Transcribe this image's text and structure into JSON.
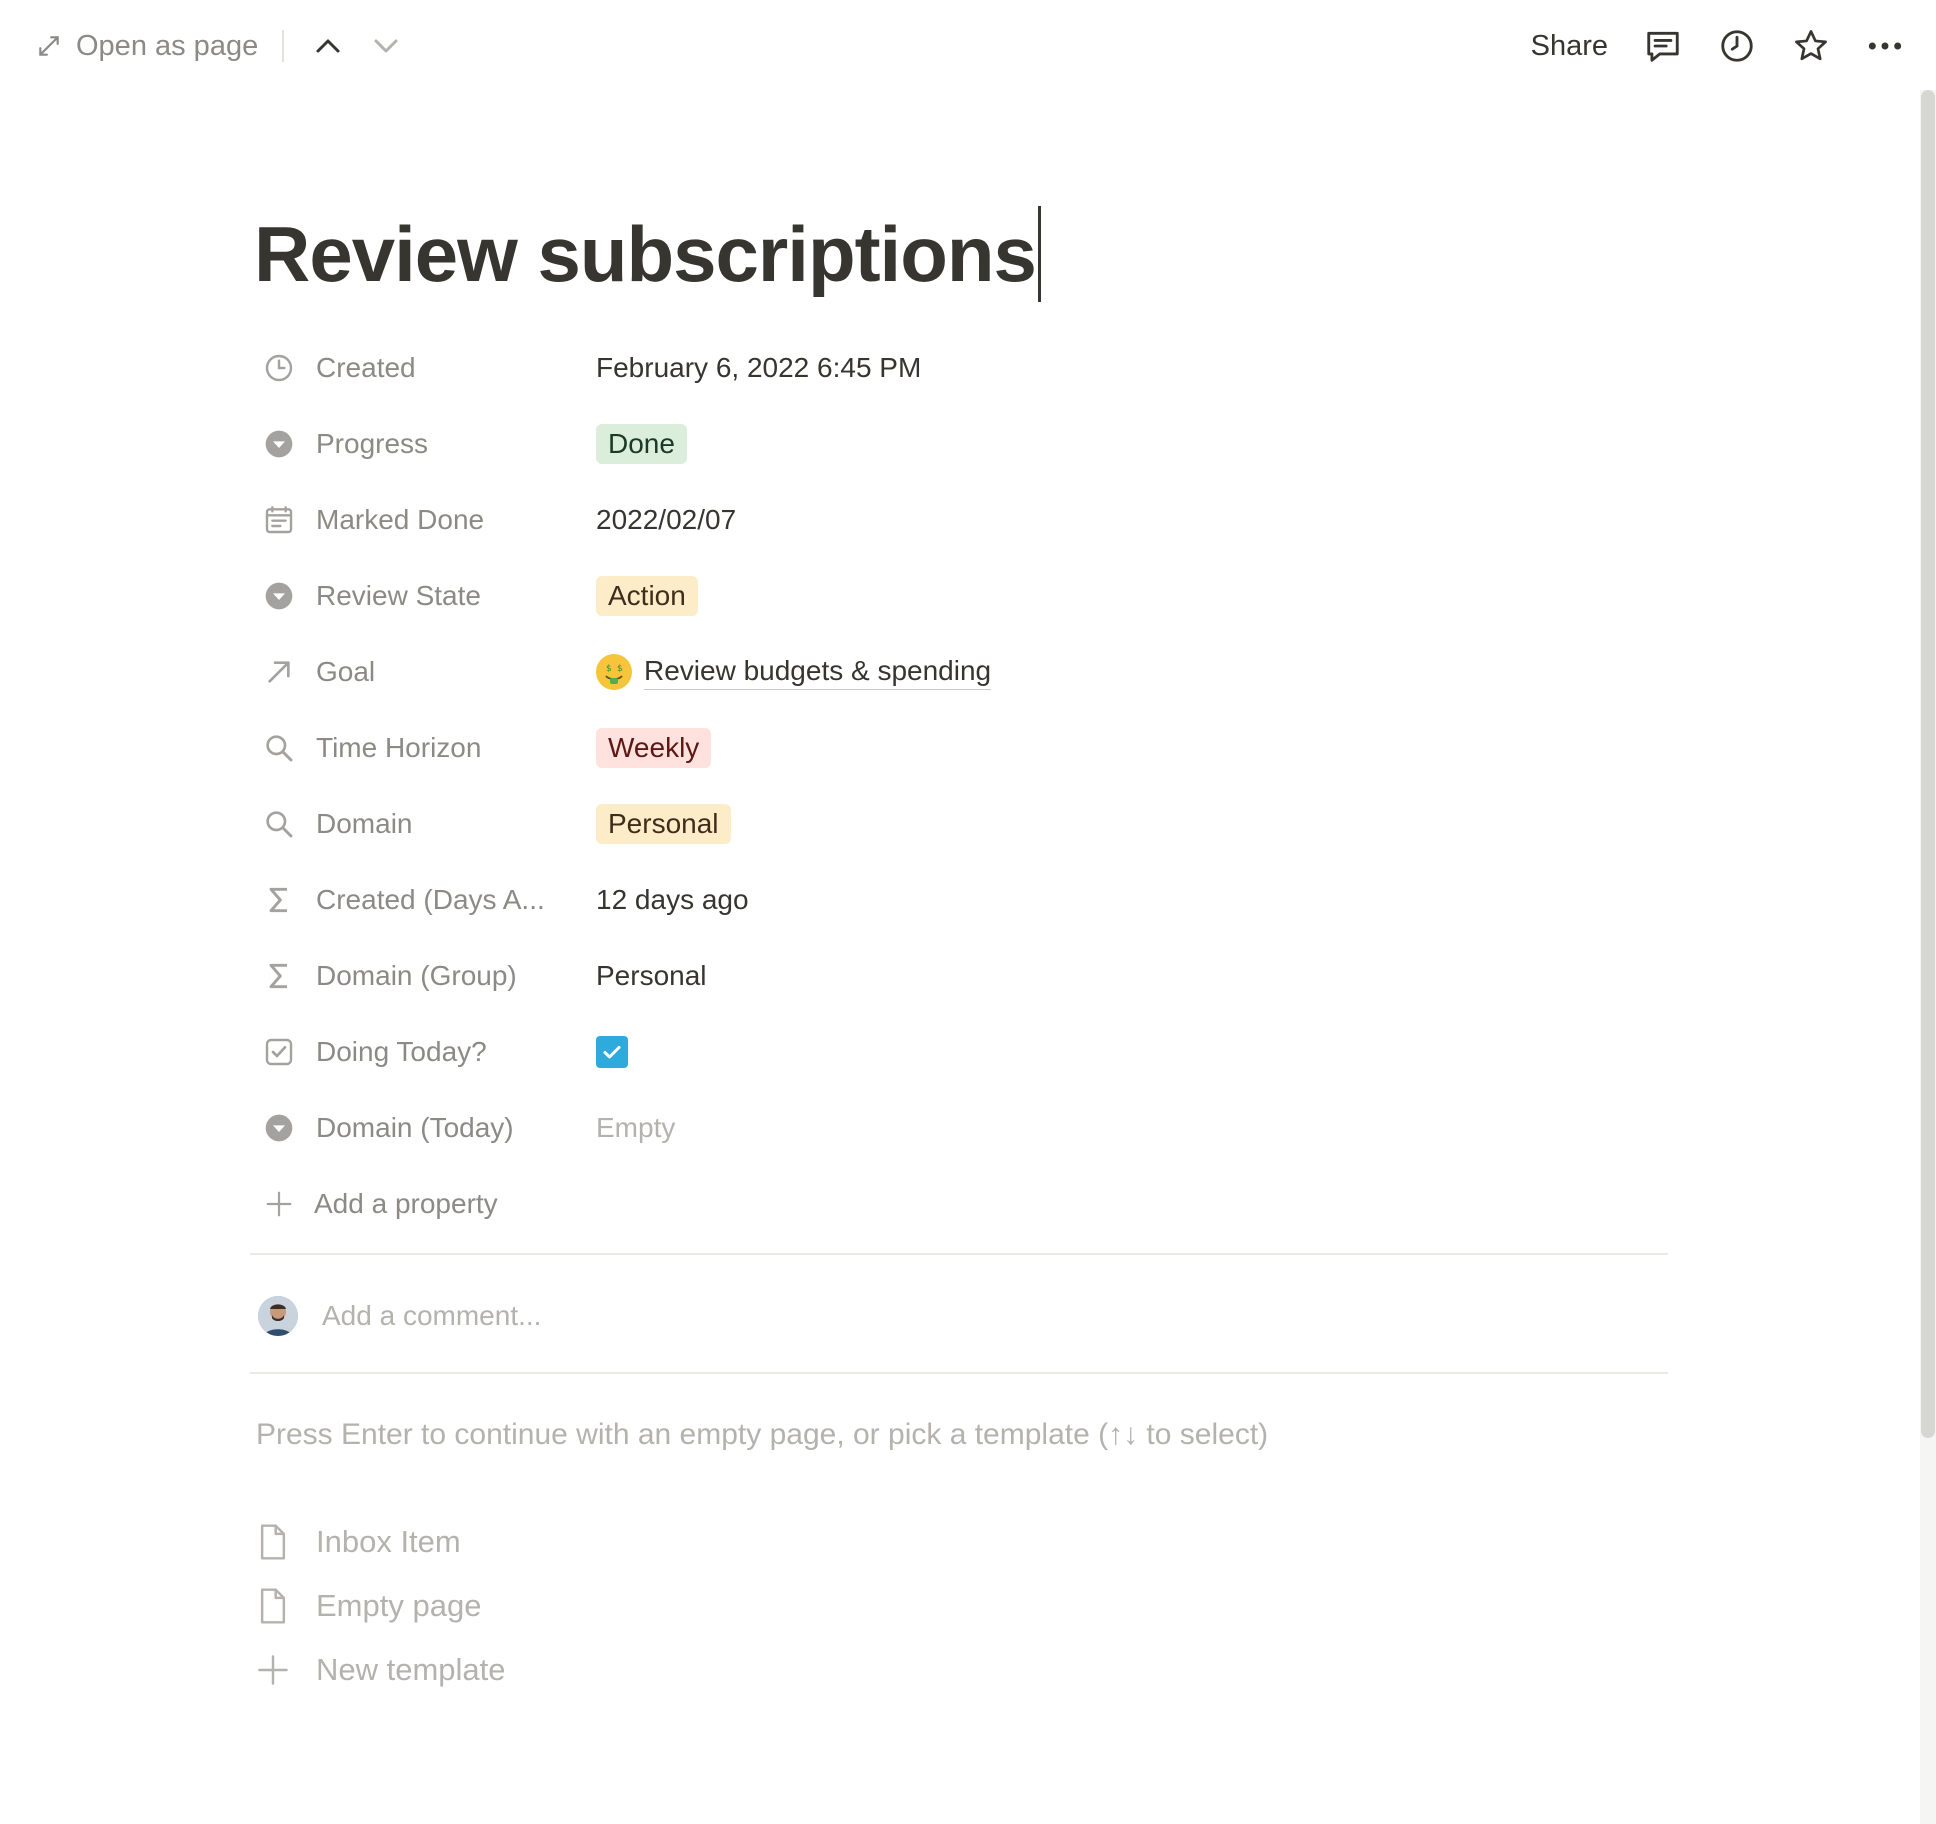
{
  "topbar": {
    "open_as_page": "Open as page",
    "share": "Share",
    "icons": [
      "expand-icon",
      "chevron-up-icon",
      "chevron-down-icon",
      "comment-icon",
      "clock-icon",
      "star-icon",
      "more-icon"
    ]
  },
  "page": {
    "title": "Review subscriptions"
  },
  "properties": [
    {
      "name": "Created",
      "icon": "clock-icon",
      "value": "February 6, 2022 6:45 PM"
    },
    {
      "name": "Progress",
      "icon": "select-icon",
      "value": "Done",
      "color": "#dbeddb"
    },
    {
      "name": "Marked Done",
      "icon": "calendar-icon",
      "value": "2022/02/07"
    },
    {
      "name": "Review State",
      "icon": "select-icon",
      "value": "Action",
      "color": "#fdecc8"
    },
    {
      "name": "Goal",
      "icon": "relation-arrow-icon",
      "value": "Review budgets & spending",
      "emoji": "money-mouth-face-icon"
    },
    {
      "name": "Time Horizon",
      "icon": "rollup-search-icon",
      "value": "Weekly",
      "color": "#ffe2dd"
    },
    {
      "name": "Domain",
      "icon": "rollup-search-icon",
      "value": "Personal",
      "color": "#fdecc8"
    },
    {
      "name": "Created (Days A...",
      "icon": "formula-sigma-icon",
      "value": "12 days ago"
    },
    {
      "name": "Domain (Group)",
      "icon": "formula-sigma-icon",
      "value": "Personal"
    },
    {
      "name": "Doing Today?",
      "icon": "checkbox-icon",
      "value": "checked",
      "checked": true
    },
    {
      "name": "Domain (Today)",
      "icon": "select-icon",
      "value": "Empty"
    }
  ],
  "add_property": "Add a property",
  "comment": {
    "placeholder": "Add a comment..."
  },
  "template_hint": "Press Enter to continue with an empty page, or pick a template (↑↓ to select)",
  "templates": [
    {
      "label": "Inbox Item",
      "icon": "page-icon"
    },
    {
      "label": "Empty page",
      "icon": "page-icon"
    },
    {
      "label": "New template",
      "icon": "plus-icon"
    }
  ],
  "colors": {
    "accent_checkbox": "#2eaadc",
    "text": "#37352f",
    "muted": "#8c8a85"
  }
}
